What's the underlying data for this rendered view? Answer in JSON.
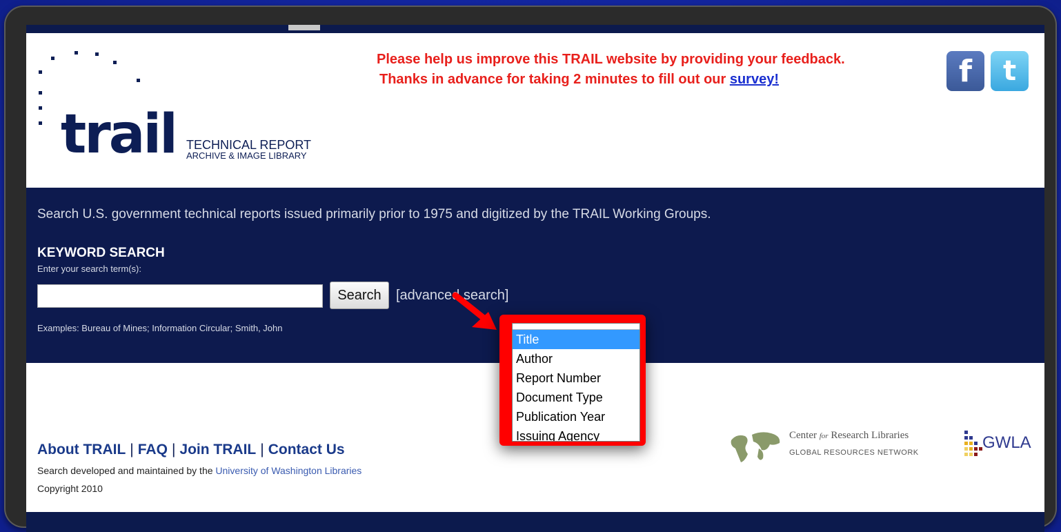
{
  "header": {
    "logo_word": "trail",
    "logo_tagline_1": "TECHNICAL REPORT",
    "logo_tagline_2": "ARCHIVE & IMAGE LIBRARY",
    "feedback_line1": "Please help us improve this TRAIL website by providing your feedback.",
    "feedback_line2_prefix": "Thanks in advance for taking 2 minutes to fill out our ",
    "survey_link": "survey!",
    "social": [
      {
        "icon": "facebook-icon",
        "glyph": "f",
        "color": "#3b5998"
      },
      {
        "icon": "twitter-icon",
        "glyph": "t",
        "color": "#3aa8e0"
      }
    ]
  },
  "search": {
    "intro": "Search U.S. government technical reports issued primarily prior to 1975 and digitized by the TRAIL Working Groups.",
    "title": "KEYWORD SEARCH",
    "hint": "Enter your search term(s):",
    "input_value": "",
    "button_label": "Search",
    "advanced_link": "[advanced search]",
    "examples": "Examples: Bureau of Mines; Information Circular; Smith, John"
  },
  "dropdown": {
    "selected": "Title",
    "options": [
      "Title",
      "Author",
      "Report Number",
      "Document Type",
      "Publication Year",
      "Issuing Agency"
    ],
    "highlight_color": "#ff0000"
  },
  "footer": {
    "links": [
      "About TRAIL",
      "FAQ",
      "Join TRAIL",
      "Contact Us"
    ],
    "maintained_prefix": "Search developed and maintained by the ",
    "maintained_link": "University of Washington Libraries",
    "copyright": "Copyright 2010",
    "crl_line1_a": "Center ",
    "crl_line1_b": "for",
    "crl_line1_c": " Research Libraries",
    "crl_line2": "GLOBAL RESOURCES NETWORK",
    "gwla": "GWLA"
  },
  "colors": {
    "navy": "#0d1a4e",
    "feedback_red": "#e8201c",
    "selection_blue": "#3399ff"
  }
}
